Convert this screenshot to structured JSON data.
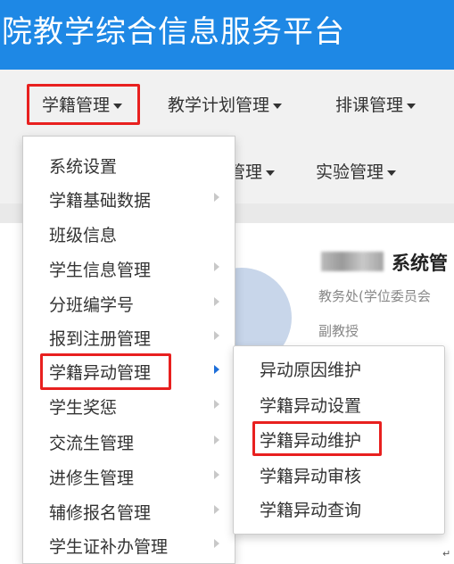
{
  "header": {
    "title": "院教学综合信息服务平台"
  },
  "nav": {
    "row1": [
      "学籍管理",
      "教学计划管理",
      "排课管理"
    ],
    "row2": [
      "管理",
      "实验管理"
    ]
  },
  "user": {
    "name": "系统管",
    "department": "教务处(学位委员会",
    "title": "副教授"
  },
  "menu": {
    "items": [
      {
        "label": "系统设置",
        "has_sub": false
      },
      {
        "label": "学籍基础数据",
        "has_sub": true
      },
      {
        "label": "班级信息",
        "has_sub": false
      },
      {
        "label": "学生信息管理",
        "has_sub": true
      },
      {
        "label": "分班编学号",
        "has_sub": true
      },
      {
        "label": "报到注册管理",
        "has_sub": true
      },
      {
        "label": "学籍异动管理",
        "has_sub": true,
        "active": true
      },
      {
        "label": "学生奖惩",
        "has_sub": true
      },
      {
        "label": "交流生管理",
        "has_sub": true
      },
      {
        "label": "进修生管理",
        "has_sub": true
      },
      {
        "label": "辅修报名管理",
        "has_sub": true
      },
      {
        "label": "学生证补办管理",
        "has_sub": true
      }
    ]
  },
  "submenu": {
    "items": [
      "异动原因维护",
      "学籍异动设置",
      "学籍异动维护",
      "学籍异动审核",
      "学籍异动查询"
    ],
    "highlighted": "学籍异动维护"
  },
  "colors": {
    "banner": "#1e88e5",
    "highlight_border": "#e8201f",
    "active_arrow": "#1e6fd9"
  }
}
